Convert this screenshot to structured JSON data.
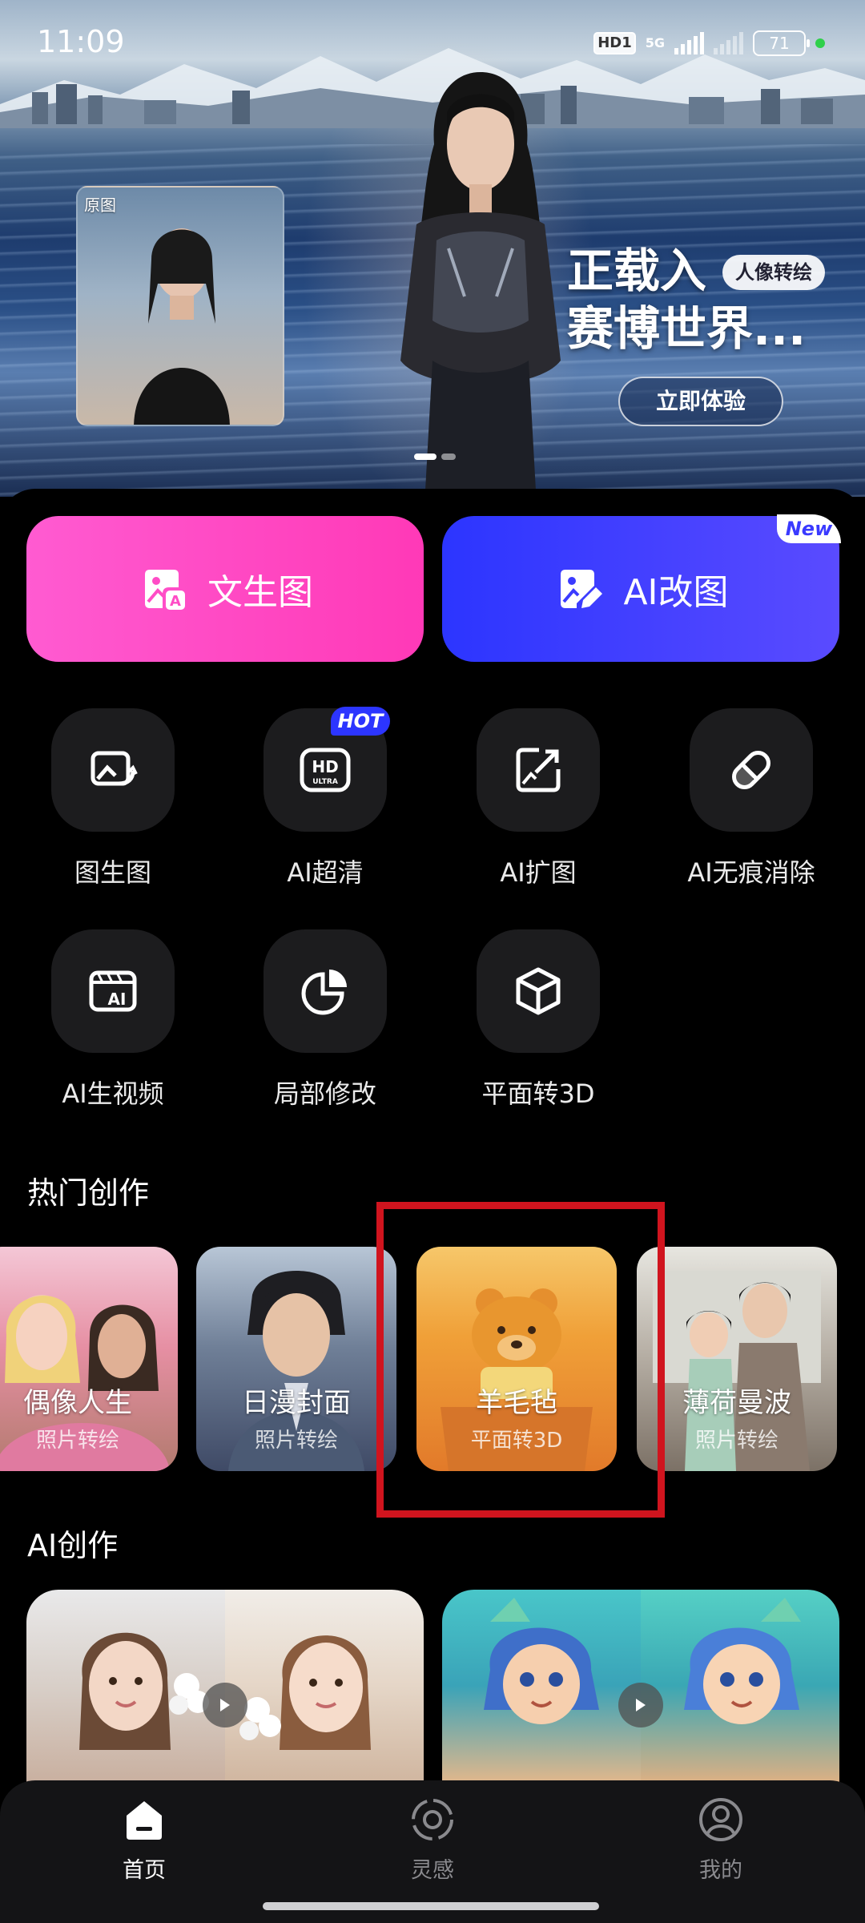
{
  "status_bar": {
    "time": "11:09",
    "hd_label": "HD1",
    "network_label": "5G",
    "battery": "71"
  },
  "banner": {
    "thumb_label": "原图",
    "title_line1": "正载入",
    "title_line2": "赛博世界...",
    "badge": "人像转绘",
    "cta": "立即体验"
  },
  "primary_actions": {
    "text_to_image": "文生图",
    "ai_edit": "AI改图",
    "new_badge": "New"
  },
  "tools": [
    {
      "label": "图生图",
      "icon": "image-to-image-icon"
    },
    {
      "label": "AI超清",
      "icon": "hd-ultra-icon",
      "badge": "HOT"
    },
    {
      "label": "AI扩图",
      "icon": "expand-image-icon"
    },
    {
      "label": "AI无痕消除",
      "icon": "eraser-icon"
    },
    {
      "label": "AI生视频",
      "icon": "ai-video-icon"
    },
    {
      "label": "局部修改",
      "icon": "partial-edit-icon"
    },
    {
      "label": "平面转3D",
      "icon": "cube-3d-icon"
    }
  ],
  "hd_icon_text": {
    "top": "HD",
    "bottom": "ULTRA"
  },
  "ai_video_icon_text": "AI",
  "hot_section": {
    "title": "热门创作",
    "cards": [
      {
        "name": "偶像人生",
        "sub": "照片转绘"
      },
      {
        "name": "日漫封面",
        "sub": "照片转绘"
      },
      {
        "name": "羊毛毡",
        "sub": "平面转3D"
      },
      {
        "name": "薄荷曼波",
        "sub": "照片转绘"
      }
    ]
  },
  "ai_section": {
    "title": "AI创作"
  },
  "bottom_nav": {
    "home": "首页",
    "inspiration": "灵感",
    "me": "我的"
  },
  "colors": {
    "pink_button": "#ff39b7",
    "blue_button": "#2c35ff",
    "highlight_box": "#d0141e",
    "tile_bg": "#1c1c1e"
  }
}
